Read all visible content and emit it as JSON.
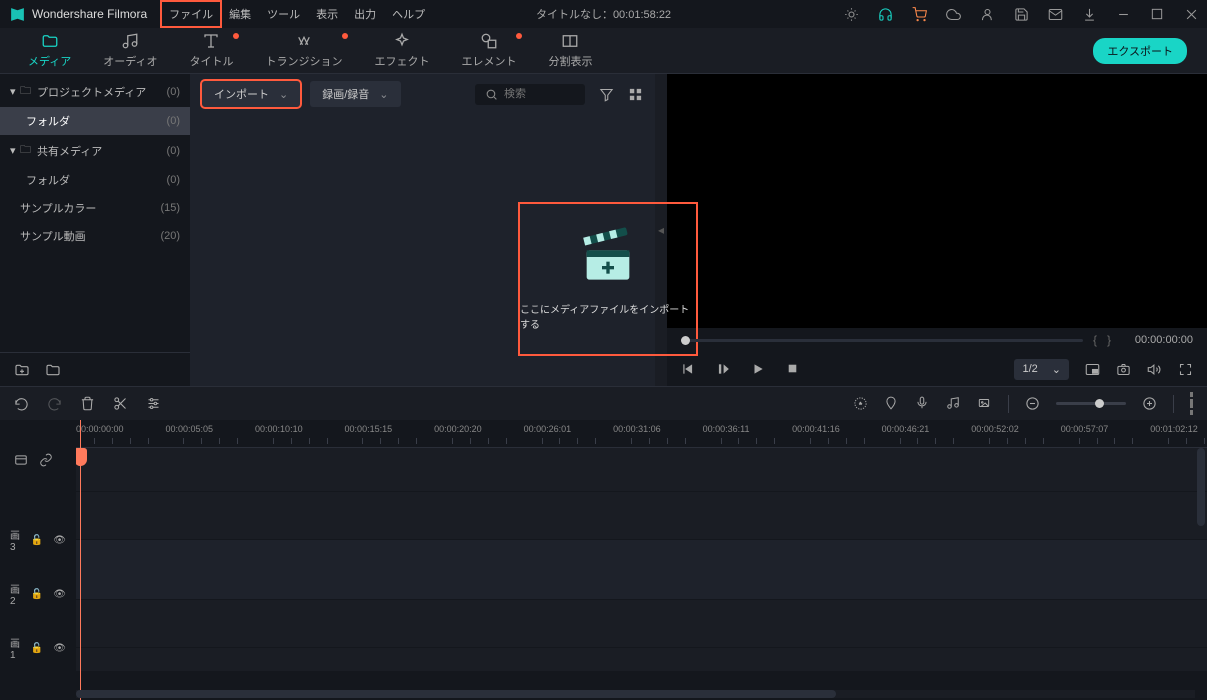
{
  "app": {
    "name": "Wondershare Filmora"
  },
  "menubar": [
    "ファイル",
    "編集",
    "ツール",
    "表示",
    "出力",
    "ヘルプ"
  ],
  "title_center": "タイトルなし：00:01:58:22",
  "tabs": [
    {
      "label": "メディア",
      "dot": false,
      "active": true
    },
    {
      "label": "オーディオ",
      "dot": false,
      "active": false
    },
    {
      "label": "タイトル",
      "dot": true,
      "active": false
    },
    {
      "label": "トランジション",
      "dot": true,
      "active": false
    },
    {
      "label": "エフェクト",
      "dot": false,
      "active": false
    },
    {
      "label": "エレメント",
      "dot": true,
      "active": false
    },
    {
      "label": "分割表示",
      "dot": false,
      "active": false
    }
  ],
  "export_label": "エクスポート",
  "sidebar": [
    {
      "label": "プロジェクトメディア",
      "count": "(0)",
      "folder": true,
      "caret": "▾",
      "indent": false,
      "selected": false
    },
    {
      "label": "フォルダ",
      "count": "(0)",
      "folder": false,
      "caret": "",
      "indent": true,
      "selected": true
    },
    {
      "label": "共有メディア",
      "count": "(0)",
      "folder": true,
      "caret": "▾",
      "indent": false,
      "selected": false
    },
    {
      "label": "フォルダ",
      "count": "(0)",
      "folder": false,
      "caret": "",
      "indent": true,
      "selected": false
    },
    {
      "label": "サンプルカラー",
      "count": "(15)",
      "folder": false,
      "caret": "",
      "indent": false,
      "selected": false
    },
    {
      "label": "サンプル動画",
      "count": "(20)",
      "folder": false,
      "caret": "",
      "indent": false,
      "selected": false
    }
  ],
  "mid": {
    "import_label": "インポート",
    "record_label": "録画/録音",
    "search_placeholder": "検索",
    "dropzone": "ここにメディアファイルをインポートする"
  },
  "preview": {
    "brace_in": "{",
    "brace_out": "}",
    "timecode": "00:00:00:00",
    "quality": "1/2"
  },
  "ruler": [
    "00:00:00:00",
    "00:00:05:05",
    "00:00:10:10",
    "00:00:15:15",
    "00:00:20:20",
    "00:00:26:01",
    "00:00:31:06",
    "00:00:36:11",
    "00:00:41:16",
    "00:00:46:21",
    "00:00:52:02",
    "00:00:57:07",
    "00:01:02:12"
  ],
  "tracks": [
    "画3",
    "画2",
    "画1"
  ]
}
